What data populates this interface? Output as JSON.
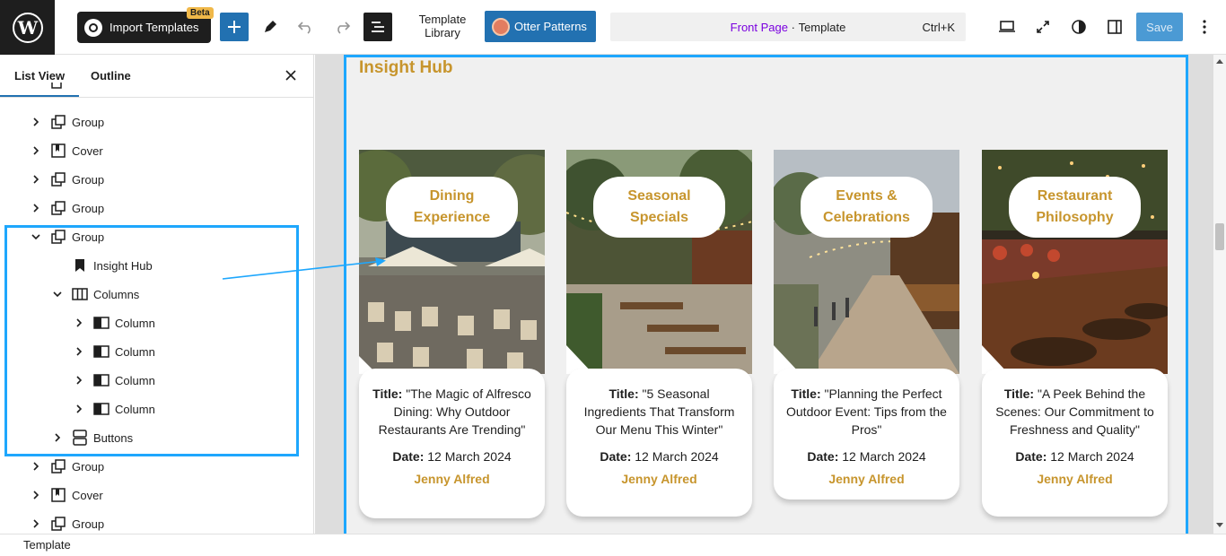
{
  "toolbar": {
    "import_label": "Import Templates",
    "beta_badge": "Beta",
    "template_library": "Template Library",
    "otter_label": "Otter Patterns",
    "command": {
      "page": "Front Page",
      "separator": " · ",
      "type": "Template",
      "shortcut": "Ctrl+K"
    },
    "save_label": "Save"
  },
  "panel": {
    "tabs": [
      "List View",
      "Outline"
    ],
    "items": [
      {
        "label": "Group",
        "icon": "group-icon",
        "depth": 0,
        "expanded": false
      },
      {
        "label": "Cover",
        "icon": "cover-icon",
        "depth": 0,
        "expanded": false
      },
      {
        "label": "Group",
        "icon": "group-icon",
        "depth": 0,
        "expanded": false
      },
      {
        "label": "Group",
        "icon": "group-icon",
        "depth": 0,
        "expanded": false
      },
      {
        "label": "Group",
        "icon": "group-icon",
        "depth": 0,
        "expanded": true
      },
      {
        "label": "Insight Hub",
        "icon": "bookmark-icon",
        "depth": 1,
        "expanded": null
      },
      {
        "label": "Columns",
        "icon": "columns-icon",
        "depth": 1,
        "expanded": true
      },
      {
        "label": "Column",
        "icon": "column-icon",
        "depth": 2,
        "expanded": false
      },
      {
        "label": "Column",
        "icon": "column-icon",
        "depth": 2,
        "expanded": false
      },
      {
        "label": "Column",
        "icon": "column-icon",
        "depth": 2,
        "expanded": false
      },
      {
        "label": "Column",
        "icon": "column-icon",
        "depth": 2,
        "expanded": false
      },
      {
        "label": "Buttons",
        "icon": "buttons-icon",
        "depth": 1,
        "expanded": false
      },
      {
        "label": "Group",
        "icon": "group-icon",
        "depth": 0,
        "expanded": false
      },
      {
        "label": "Cover",
        "icon": "cover-icon",
        "depth": 0,
        "expanded": false
      },
      {
        "label": "Group",
        "icon": "group-icon",
        "depth": 0,
        "expanded": false
      }
    ]
  },
  "canvas": {
    "heading": "Insight Hub",
    "cards": [
      {
        "category": "Dining Experience",
        "title_label": "Title:",
        "title": "\"The Magic of Alfresco Dining: Why Outdoor Restaurants Are Trending\"",
        "date_label": "Date:",
        "date": "12 March 2024",
        "author": "Jenny Alfred"
      },
      {
        "category": "Seasonal Specials",
        "title_label": "Title:",
        "title": "\"5 Seasonal Ingredients That Transform Our Menu This Winter\"",
        "date_label": "Date:",
        "date": "12 March 2024",
        "author": "Jenny Alfred"
      },
      {
        "category": "Events & Celebrations",
        "title_label": "Title:",
        "title": "\"Planning the Perfect Outdoor Event: Tips from the Pros\"",
        "date_label": "Date:",
        "date": "12 March 2024",
        "author": "Jenny Alfred"
      },
      {
        "category": "Restaurant Philosophy",
        "title_label": "Title:",
        "title": "\"A Peek Behind the Scenes: Our Commitment to Freshness and Quality\"",
        "date_label": "Date:",
        "date": "12 March 2024",
        "author": "Jenny Alfred"
      }
    ]
  },
  "footer": {
    "breadcrumb": "Template"
  },
  "colors": {
    "accent": "#2271b1",
    "selection": "#1ea7fd",
    "gold": "#c7952d",
    "purple": "#7a00df"
  }
}
